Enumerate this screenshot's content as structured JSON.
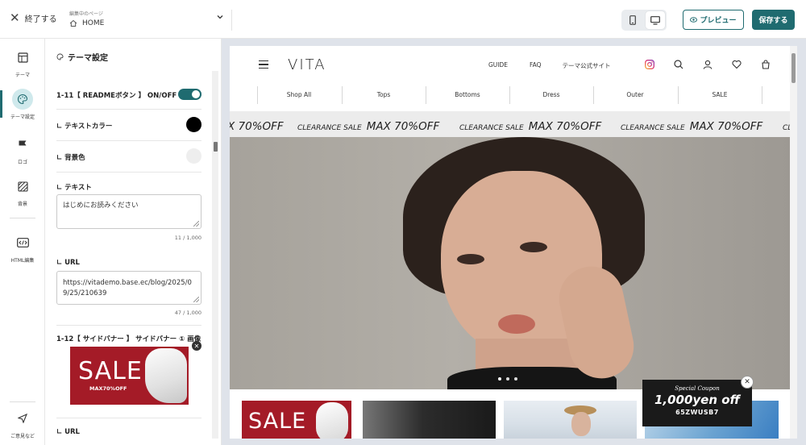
{
  "topbar": {
    "exit_label": "終了する",
    "page_caption": "編集中のページ",
    "page_name": "HOME",
    "preview_label": "プレビュー",
    "save_label": "保存する"
  },
  "rail": {
    "items": [
      {
        "label": "テーマ",
        "icon": "layout-icon"
      },
      {
        "label": "テーマ設定",
        "icon": "palette-icon"
      },
      {
        "label": "ロゴ",
        "icon": "flag-icon"
      },
      {
        "label": "背景",
        "icon": "texture-icon"
      },
      {
        "label": "HTML編集",
        "icon": "code-icon"
      },
      {
        "label": "ご意見など",
        "icon": "send-icon"
      }
    ]
  },
  "panel": {
    "title": "テーマ設定",
    "toggle_label": "1-11【 READMEボタン 】 ON/OFF",
    "text_color_label": "∟ テキストカラー",
    "bg_color_label": "∟ 背景色",
    "text_label": "∟ テキスト",
    "text_value": "はじめにお読みください",
    "text_counter": "11 / 1,000",
    "url_label": "∟ URL",
    "url_value": "https://vitademo.base.ec/blog/2025/09/25/210639",
    "url_counter": "47 / 1,000",
    "sidebanner_label": "1-12【 サイドバナー 】 サイドバナー ① 画像",
    "banner_sale": "SALE",
    "banner_off": "MAX70%OFF",
    "url2_label": "∟ URL",
    "colors": {
      "text_color": "#000000",
      "bg_color": "#eeeeee",
      "accent": "#1f6b70"
    }
  },
  "site": {
    "logo": "VITA",
    "links": [
      "GUIDE",
      "FAQ",
      "テーマ公式サイト"
    ],
    "categories": [
      "Shop All",
      "Tops",
      "Bottoms",
      "Dress",
      "Outer",
      "SALE"
    ],
    "marquee_a": "CLEARANCE SALE",
    "marquee_b": "MAX 70%OFF",
    "marquee_lead": "X 70%OFF",
    "marquee_tail": "CL",
    "thumb_sale": "SALE",
    "coupon": {
      "script": "Special Coupon",
      "amount": "1,000yen off",
      "code": "65ZWUSB7"
    }
  }
}
